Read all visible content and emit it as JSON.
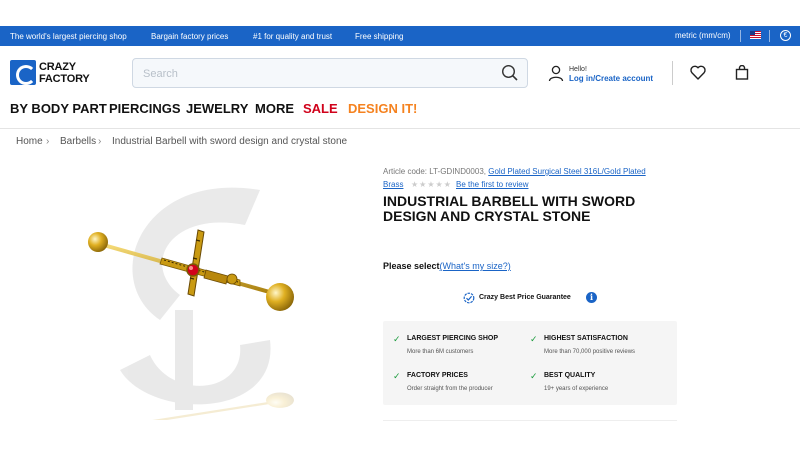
{
  "topbar": {
    "usps": [
      "The world's largest piercing shop",
      "Bargain factory prices",
      "#1 for quality and trust",
      "Free shipping"
    ],
    "metric": "metric (mm/cm)",
    "currency_symbol": "€"
  },
  "header": {
    "logo_line1": "CRAZY",
    "logo_line2": "FACTORY",
    "search_placeholder": "Search",
    "account_hello": "Hello!",
    "account_login": "Log in/Create account"
  },
  "nav": {
    "items": [
      "BY BODY PART",
      "PIERCINGS",
      "JEWELRY",
      "MORE",
      "SALE",
      "DESIGN IT!"
    ],
    "colors": {
      "default": "#111111",
      "sale": "#d0021b",
      "design": "#f5821f"
    }
  },
  "breadcrumb": [
    "Home",
    "Barbells",
    "Industrial Barbell with sword design and crystal stone"
  ],
  "product": {
    "article_prefix": "Article code: LT-GDIND0003,",
    "material_link_1": "Gold Plated Surgical Steel 316L/Gold Plated",
    "material_link_2": "Brass",
    "rating_stars": "★★★★★",
    "review_link": "Be the first to review",
    "title": "INDUSTRIAL BARBELL WITH SWORD DESIGN AND CRYSTAL STONE",
    "select_label": "Please select",
    "size_link": "(What's my size?)"
  },
  "guarantee": {
    "label": "Crazy Best Price Guarantee",
    "info_icon": "i"
  },
  "benefits": [
    {
      "title": "LARGEST PIERCING SHOP",
      "sub": "More than 6M customers"
    },
    {
      "title": "HIGHEST SATISFACTION",
      "sub": "More than 70,000 positive reviews"
    },
    {
      "title": "FACTORY PRICES",
      "sub": "Order straight from the producer"
    },
    {
      "title": "BEST QUALITY",
      "sub": "19+ years of experience"
    }
  ],
  "colors": {
    "brand_blue": "#1a64c6",
    "gold": "#d4a017",
    "crystal_red": "#d0021b",
    "check_green": "#1a9b3c"
  }
}
